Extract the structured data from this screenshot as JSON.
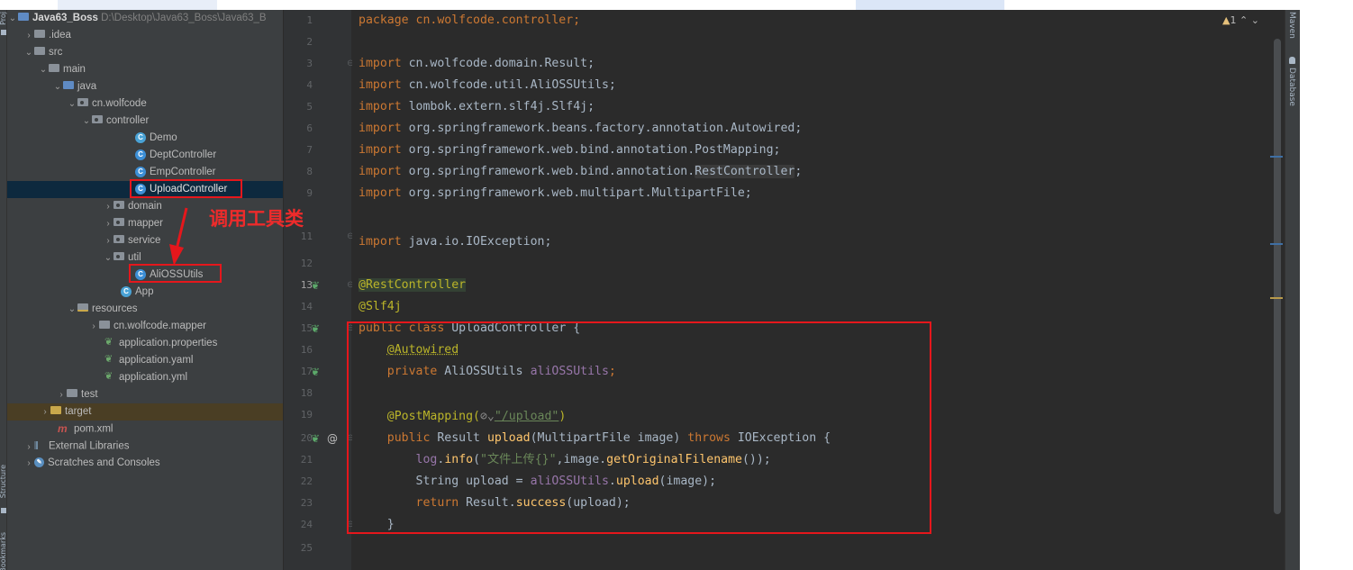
{
  "left_strip": {
    "project_label": "Proj",
    "structure_label": "Structure",
    "bookmarks_label": "Bookmarks"
  },
  "tree": {
    "project_name": "Java63_Boss",
    "project_path": "D:\\Desktop\\Java63_Boss\\Java63_B",
    "items": [
      "Java63_Boss",
      ".idea",
      "src",
      "main",
      "java",
      "cn.wolfcode",
      "controller",
      "Demo",
      "DeptController",
      "EmpController",
      "UploadController",
      "domain",
      "mapper",
      "service",
      "util",
      "AliOSSUtils",
      "App",
      "resources",
      "cn.wolfcode.mapper",
      "application.properties",
      "application.yaml",
      "application.yml",
      "test",
      "target",
      "pom.xml",
      "External Libraries",
      "Scratches and Consoles"
    ]
  },
  "annotation": {
    "text": "调用工具类"
  },
  "editor": {
    "line_numbers": [
      "1",
      "2",
      "3",
      "4",
      "5",
      "6",
      "7",
      "8",
      "9",
      "11",
      "12",
      "13",
      "14",
      "15",
      "16",
      "17",
      "18",
      "19",
      "20",
      "21",
      "22",
      "23",
      "24",
      "25"
    ],
    "warnings": "1",
    "code": {
      "l1": "package cn.wolfcode.controller;",
      "import_kw": "import",
      "l3": "cn.wolfcode.domain.Result;",
      "l4": "cn.wolfcode.util.AliOSSUtils;",
      "l5": "lombok.extern.slf4j.Slf4j;",
      "l6": "org.springframework.beans.factory.annotation.Autowired;",
      "l7": "org.springframework.web.bind.annotation.PostMapping;",
      "l8a": "org.springframework.web.bind.annotation.",
      "l8b": "RestController",
      "l8c": ";",
      "l9": "org.springframework.web.multipart.MultipartFile;",
      "l11": "java.io.IOException;",
      "l13": "@RestController",
      "l14": "@Slf4j",
      "l15_kw": "public class",
      "l15_rest": " UploadController {",
      "l16": "@Autowired",
      "l17_kw": "private",
      "l17_type": " AliOSSUtils ",
      "l17_field": "aliOSSUtils",
      "l17_end": ";",
      "l19_ann": "@PostMapping(",
      "l19_icon": "⊘⌄",
      "l19_str": "\"/upload\"",
      "l19_end": ")",
      "l20_kw": "public",
      "l20_type": " Result ",
      "l20_fn": "upload",
      "l20_mid": "(MultipartFile image) ",
      "l20_throws": "throws",
      "l20_end": " IOException {",
      "l21_field": "log",
      "l21_dot": ".",
      "l21_fn": "info",
      "l21_open": "(",
      "l21_str": "\"文件上传{}\"",
      "l21_mid": ",image.",
      "l21_fn2": "getOriginalFilename",
      "l21_end": "());",
      "l22_type": "String upload = ",
      "l22_field": "aliOSSUtils",
      "l22_dot": ".",
      "l22_fn": "upload",
      "l22_end": "(image);",
      "l23_kw": "return",
      "l23_mid": " Result.",
      "l23_fn": "success",
      "l23_end": "(upload);",
      "l24": "}"
    }
  },
  "right_strip": {
    "maven_label": "Maven",
    "database_label": "Database"
  }
}
